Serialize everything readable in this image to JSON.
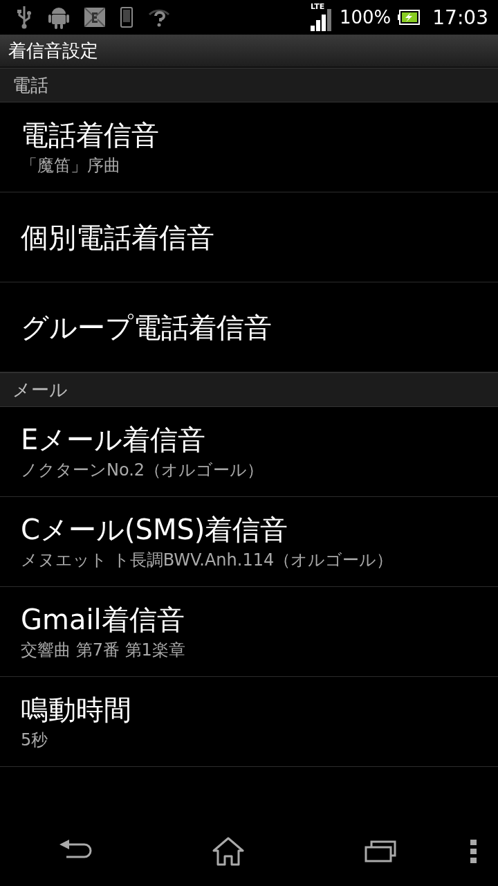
{
  "status_bar": {
    "network": "LTE",
    "battery": "100%",
    "time": "17:03"
  },
  "title": "着信音設定",
  "sections": [
    {
      "title": "電話",
      "items": [
        {
          "title": "電話着信音",
          "summary": "「魔笛」序曲"
        },
        {
          "title": "個別電話着信音"
        },
        {
          "title": "グループ電話着信音"
        }
      ]
    },
    {
      "title": "メール",
      "items": [
        {
          "title": "Eメール着信音",
          "summary": "ノクターンNo.2（オルゴール）"
        },
        {
          "title": "Cメール(SMS)着信音",
          "summary": "メヌエット ト長調BWV.Anh.114（オルゴール）"
        },
        {
          "title": "Gmail着信音",
          "summary": "交響曲 第7番 第1楽章"
        },
        {
          "title": "鳴動時間",
          "summary": "5秒"
        }
      ]
    }
  ]
}
